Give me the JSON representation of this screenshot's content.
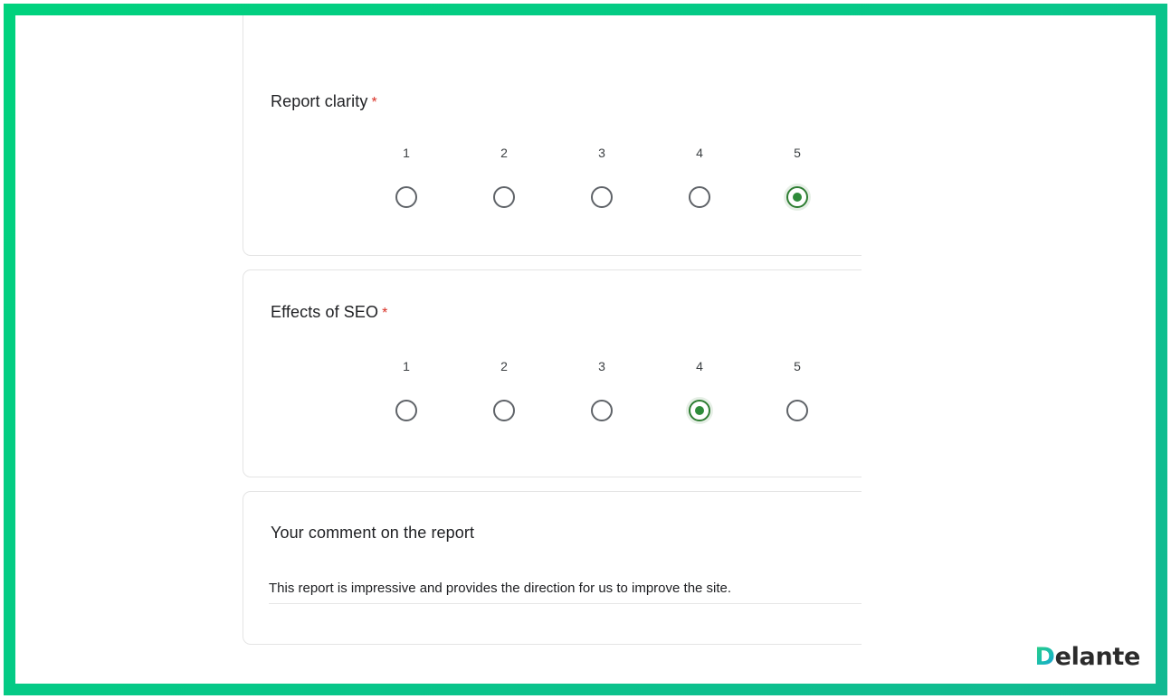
{
  "questions": [
    {
      "title": "Report clarity",
      "required_marker": "*",
      "options": [
        "1",
        "2",
        "3",
        "4",
        "5"
      ],
      "selected": "5"
    },
    {
      "title": "Effects of SEO",
      "required_marker": "*",
      "options": [
        "1",
        "2",
        "3",
        "4",
        "5"
      ],
      "selected": "4"
    },
    {
      "title": "Your comment on the report",
      "answer": "This report is impressive and provides the direction for us to improve the site."
    }
  ],
  "brand": {
    "first_letter": "D",
    "rest": "elante"
  },
  "colors": {
    "frame_light": "#00d27d",
    "frame_dark": "#12b993",
    "radio_selected": "#2e7d32",
    "required": "#d93025"
  }
}
